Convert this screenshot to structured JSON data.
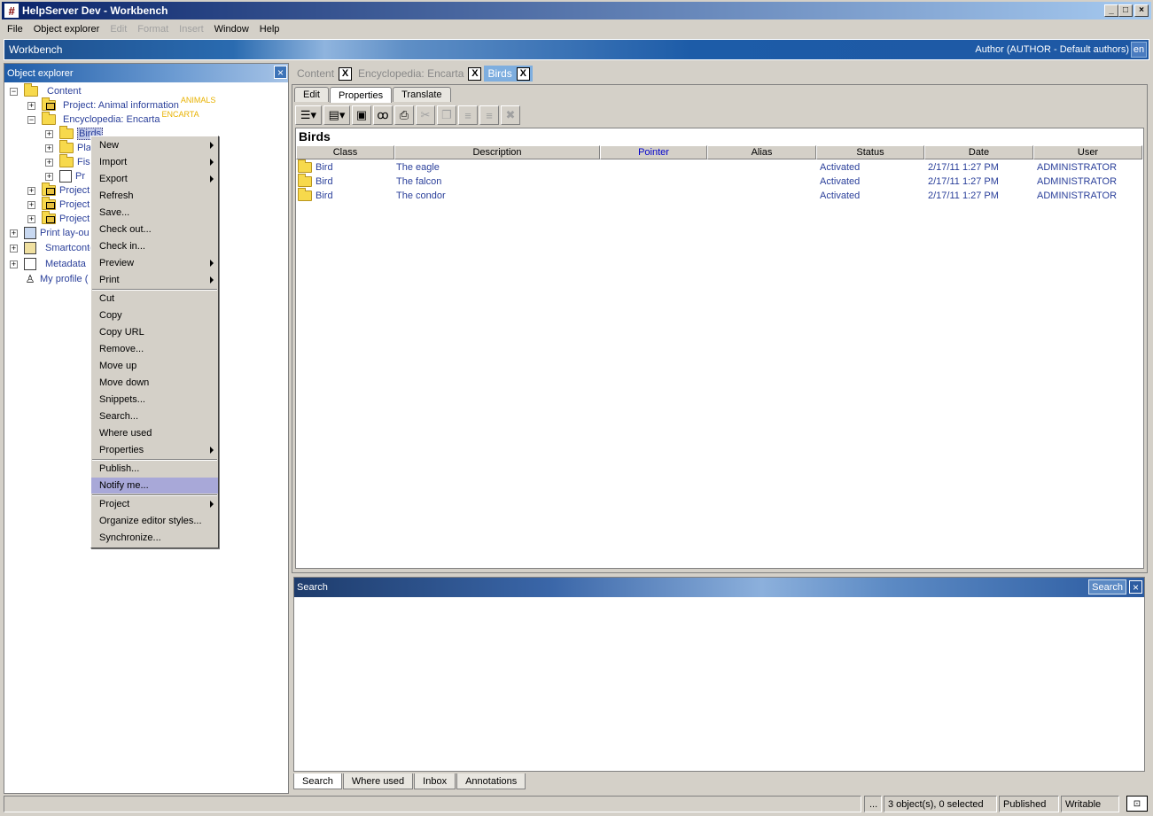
{
  "window": {
    "title": "HelpServer Dev - Workbench",
    "app_icon": "#",
    "controls": {
      "minimize": "_",
      "maximize": "□",
      "close": "×"
    }
  },
  "menubar": {
    "items": [
      {
        "label": "File",
        "disabled": false
      },
      {
        "label": "Object explorer",
        "disabled": false
      },
      {
        "label": "Edit",
        "disabled": true
      },
      {
        "label": "Format",
        "disabled": true
      },
      {
        "label": "Insert",
        "disabled": true
      },
      {
        "label": "Window",
        "disabled": false
      },
      {
        "label": "Help",
        "disabled": false
      }
    ]
  },
  "workbench": {
    "title": "Workbench",
    "author": "Author (AUTHOR - Default authors)",
    "lang": "en"
  },
  "object_explorer": {
    "title": "Object explorer",
    "close": "×",
    "tree": {
      "content": "Content",
      "project_animal": "Project: Animal information",
      "project_animal_tag": "ANIMALS",
      "encyclopedia": "Encyclopedia: Encarta",
      "encyclopedia_tag": "ENCARTA",
      "birds": "Birds",
      "pla": "Pla",
      "fis": "Fis",
      "pr": "Pr",
      "project1": "Project",
      "project2": "Project",
      "project3": "Project",
      "print_layout": "Print lay-ou",
      "smartcontent": "Smartconte",
      "metadata": "Metadata",
      "my_profile": "My profile ("
    }
  },
  "context_menu": {
    "items": [
      {
        "label": "New"
      },
      {
        "label": "Import"
      },
      {
        "label": "Export"
      },
      {
        "label": "Refresh"
      },
      {
        "label": "Save..."
      },
      {
        "label": "Check out..."
      },
      {
        "label": "Check in..."
      },
      {
        "label": "Preview"
      },
      {
        "label": "Print"
      },
      {
        "label": "Cut"
      },
      {
        "label": "Copy"
      },
      {
        "label": "Copy URL"
      },
      {
        "label": "Remove..."
      },
      {
        "label": "Move up"
      },
      {
        "label": "Move down"
      },
      {
        "label": "Snippets..."
      },
      {
        "label": "Search..."
      },
      {
        "label": "Where used"
      },
      {
        "label": "Properties"
      },
      {
        "label": "Publish..."
      },
      {
        "label": "Notify me..."
      },
      {
        "label": "Project"
      },
      {
        "label": "Organize editor styles..."
      },
      {
        "label": "Synchronize..."
      }
    ],
    "highlighted": "Notify me..."
  },
  "doc_tabs": [
    {
      "label": "Content",
      "close": "X"
    },
    {
      "label": "Encyclopedia: Encarta",
      "close": "X"
    },
    {
      "label": "Birds",
      "close": "X"
    }
  ],
  "editor": {
    "subtabs": [
      "Edit",
      "Properties",
      "Translate"
    ],
    "active_subtab": "Properties",
    "heading": "Birds",
    "columns": [
      "Class",
      "Description",
      "Pointer",
      "Alias",
      "Status",
      "Date",
      "User"
    ],
    "rows": [
      [
        "Bird",
        "The eagle",
        "",
        "",
        "Activated",
        "2/17/11 1:27 PM",
        "ADMINISTRATOR"
      ],
      [
        "Bird",
        "The falcon",
        "",
        "",
        "Activated",
        "2/17/11 1:27 PM",
        "ADMINISTRATOR"
      ],
      [
        "Bird",
        "The condor",
        "",
        "",
        "Activated",
        "2/17/11 1:27 PM",
        "ADMINISTRATOR"
      ]
    ]
  },
  "search_panel": {
    "title": "Search",
    "button": "Search",
    "close": "×",
    "tabs": [
      "Search",
      "Where used",
      "Inbox",
      "Annotations"
    ]
  },
  "statusbar": {
    "dots": "...",
    "selection": "3 object(s), 0 selected",
    "state": "Published",
    "mode": "Writable"
  }
}
